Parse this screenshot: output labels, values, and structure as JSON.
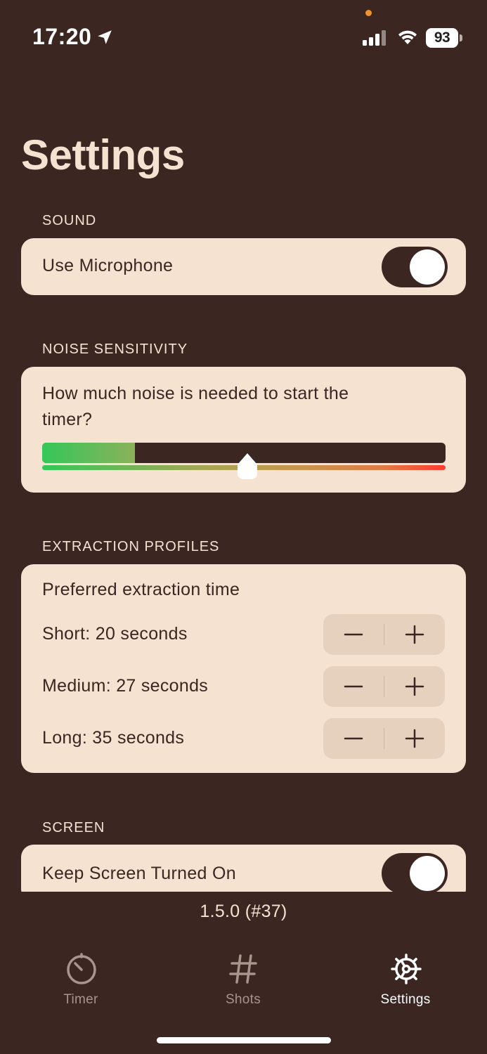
{
  "status_bar": {
    "time": "17:20",
    "battery": "93",
    "icons": [
      "location-arrow-icon",
      "cellular-signal-icon",
      "wifi-icon",
      "battery-icon"
    ]
  },
  "page": {
    "title": "Settings"
  },
  "sections": {
    "sound": {
      "header": "SOUND",
      "use_microphone": {
        "label": "Use Microphone",
        "on": true
      }
    },
    "noise": {
      "header": "NOISE SENSITIVITY",
      "question": "How much noise is needed to start the timer?",
      "current_level": 0.23,
      "threshold": 0.508
    },
    "extraction": {
      "header": "EXTRACTION PROFILES",
      "subtitle": "Preferred extraction time",
      "profiles": [
        {
          "label": "Short: 20 seconds"
        },
        {
          "label": "Medium: 27 seconds"
        },
        {
          "label": "Long: 35 seconds"
        }
      ]
    },
    "screen": {
      "header": "SCREEN",
      "keep_screen_on": {
        "label": "Keep Screen Turned On",
        "on": true
      }
    }
  },
  "version": "1.5.0 (#37)",
  "tabs": [
    {
      "label": "Timer",
      "icon": "timer-icon",
      "selected": false
    },
    {
      "label": "Shots",
      "icon": "hash-icon",
      "selected": false
    },
    {
      "label": "Settings",
      "icon": "gear-icon",
      "selected": true
    }
  ],
  "colors": {
    "background": "#3b2622",
    "card": "#f5e2d0",
    "tab_inactive": "#a8958d",
    "tab_active": "#ffffff",
    "meter_green": "#34c759",
    "meter_red": "#ff3b30"
  }
}
